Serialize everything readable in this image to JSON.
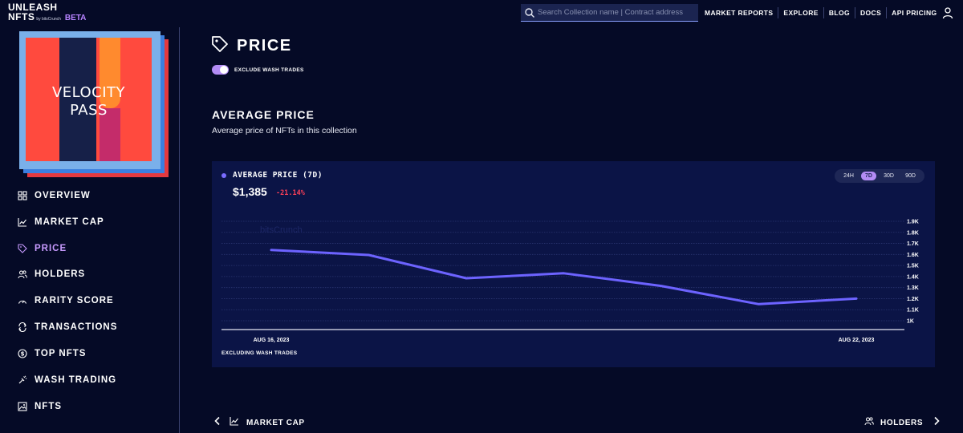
{
  "header": {
    "logo_line1": "UNLEASH",
    "logo_line2": "NFTS",
    "logo_by": "by bitsCrunch",
    "logo_badge": "BETA",
    "search_placeholder": "Search Collection name | Contract address",
    "nav": [
      "MARKET REPORTS",
      "EXPLORE",
      "BLOG",
      "DOCS",
      "API PRICING"
    ]
  },
  "collection": {
    "cover_title_line1": "VELOCITY",
    "cover_title_line2": "PASS"
  },
  "sidebar": {
    "items": [
      {
        "label": "OVERVIEW",
        "icon": "grid-icon"
      },
      {
        "label": "MARKET CAP",
        "icon": "trend-chart-icon"
      },
      {
        "label": "PRICE",
        "icon": "tag-icon",
        "active": true
      },
      {
        "label": "HOLDERS",
        "icon": "users-icon"
      },
      {
        "label": "RARITY SCORE",
        "icon": "gauge-icon"
      },
      {
        "label": "TRANSACTIONS",
        "icon": "swap-icon"
      },
      {
        "label": "TOP NFTS",
        "icon": "dollar-coin-icon"
      },
      {
        "label": "WASH TRADING",
        "icon": "wash-icon"
      },
      {
        "label": "NFTS",
        "icon": "image-icon"
      }
    ]
  },
  "main": {
    "title": "PRICE",
    "toggle_label": "EXCLUDE WASH TRADES",
    "toggle_on": true,
    "section_title": "AVERAGE PRICE",
    "section_subtitle": "Average price of NFTs in this collection"
  },
  "chart_card": {
    "legend": "AVERAGE PRICE (7D)",
    "value": "$1,385",
    "change": "-21.14%",
    "ranges": [
      "24H",
      "7D",
      "30D",
      "90D"
    ],
    "selected_range": "7D",
    "watermark": "bitsCrunch",
    "footnote": "EXCLUDING WASH TRADES"
  },
  "chart_data": {
    "type": "line",
    "x": [
      "AUG 16, 2023",
      "AUG 17, 2023",
      "AUG 18, 2023",
      "AUG 19, 2023",
      "AUG 20, 2023",
      "AUG 21, 2023",
      "AUG 22, 2023"
    ],
    "x_tick_labels": [
      "AUG 16, 2023",
      "AUG 22, 2023"
    ],
    "series": [
      {
        "values": [
          1640,
          1595,
          1385,
          1430,
          1315,
          1150,
          1200
        ]
      }
    ],
    "y_tick_labels": [
      "1K",
      "1.1K",
      "1.2K",
      "1.3K",
      "1.4K",
      "1.5K",
      "1.6K",
      "1.7K",
      "1.8K",
      "1.9K"
    ],
    "ylim": [
      1000,
      1900
    ],
    "grid": true,
    "line_color": "#6d63ff"
  },
  "pager": {
    "prev_label": "MARKET CAP",
    "next_label": "HOLDERS"
  }
}
